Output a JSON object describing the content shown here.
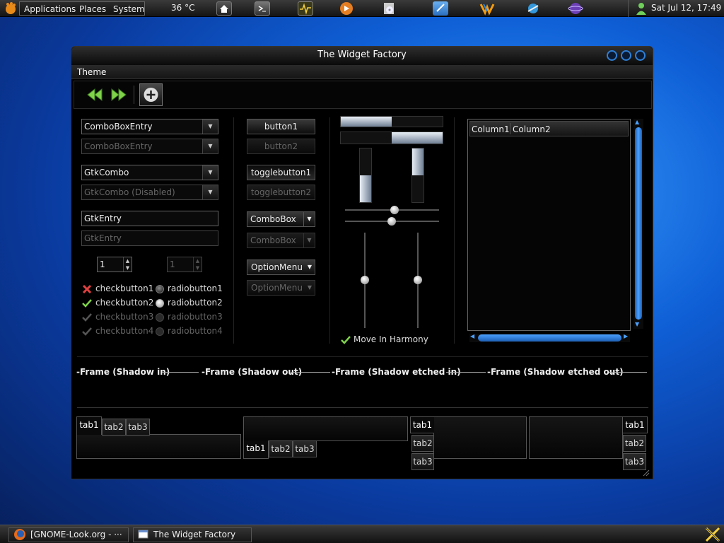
{
  "panel": {
    "menus": [
      "Applications",
      "Places",
      "System"
    ],
    "temperature": "36 °C",
    "datetime": "Sat Jul 12, 17:49"
  },
  "window": {
    "title": "The Widget Factory",
    "menubar": [
      "Theme"
    ]
  },
  "col1": {
    "combo_entry": "ComboBoxEntry",
    "combo_entry_disabled": "ComboBoxEntry",
    "gtk_combo": "GtkCombo",
    "gtk_combo_disabled": "GtkCombo (Disabled)",
    "entry": "GtkEntry",
    "entry_disabled": "GtkEntry",
    "spin1": "1",
    "spin2": "1",
    "checks": [
      "checkbutton1",
      "checkbutton2",
      "checkbutton3",
      "checkbutton4"
    ],
    "radios": [
      "radiobutton1",
      "radiobutton2",
      "radiobutton3",
      "radiobutton4"
    ]
  },
  "col2": {
    "button1": "button1",
    "button2": "button2",
    "toggle1": "togglebutton1",
    "toggle2": "togglebutton2",
    "combobox1": "ComboBox",
    "combobox2": "ComboBox",
    "option1": "OptionMenu",
    "option2": "OptionMenu"
  },
  "col3": {
    "harmony": "Move In Harmony"
  },
  "tree": {
    "columns": [
      "Column1",
      "Column2"
    ]
  },
  "frames": [
    "-Frame (Shadow in)",
    "-Frame (Shadow out)",
    "-Frame (Shadow etched in)",
    "-Frame (Shadow etched out)"
  ],
  "tabs": [
    "tab1",
    "tab2",
    "tab3"
  ],
  "taskbar": [
    "[GNOME-Look.org - ···",
    "The Widget Factory"
  ],
  "colors": {
    "accent": "#2f7fd6",
    "check_green": "#7fd34a",
    "check_red": "#e04040"
  }
}
